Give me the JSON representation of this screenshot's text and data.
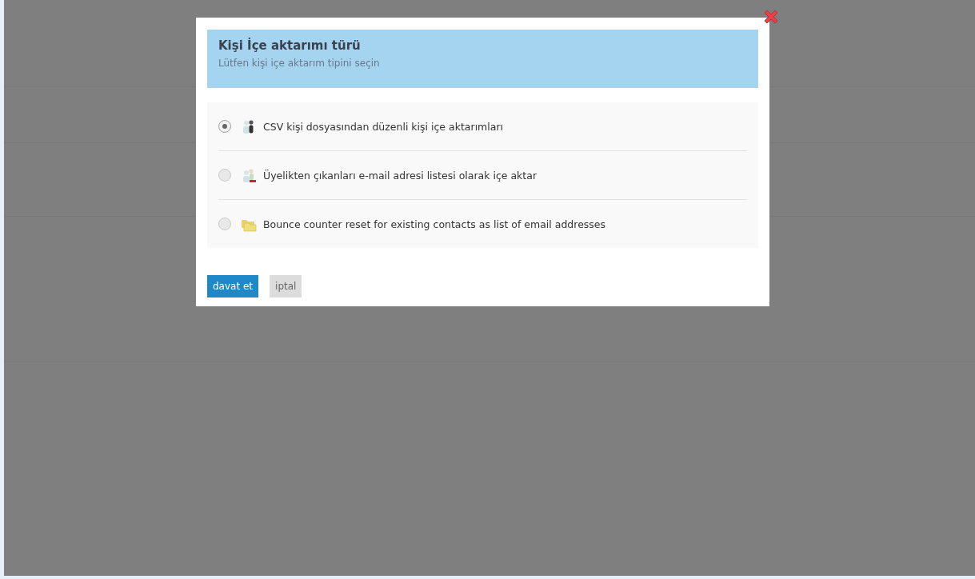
{
  "dialog": {
    "title": "Kişi İçe aktarımı türü",
    "subtitle": "Lütfen kişi içe aktarım tipini seçin",
    "options": [
      {
        "label": "CSV kişi dosyasından düzenli kişi içe aktarımları",
        "selected": true
      },
      {
        "label": "Üyelikten çıkanları e-mail adresi listesi olarak içe aktar",
        "selected": false
      },
      {
        "label": "Bounce counter reset for existing contacts as list of email addresses",
        "selected": false
      }
    ],
    "buttons": [
      {
        "label": "davat et",
        "kind": "primary"
      },
      {
        "label": "iptal",
        "kind": "secondary"
      }
    ]
  }
}
